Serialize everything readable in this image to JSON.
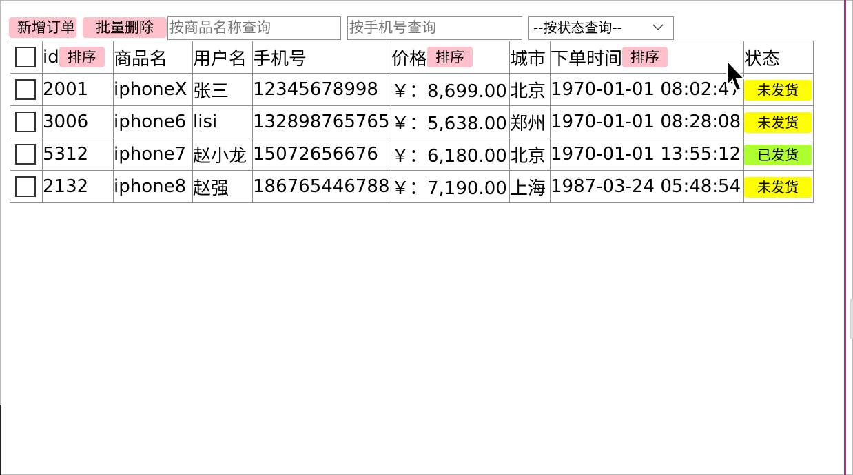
{
  "toolbar": {
    "add_label": "新增订单",
    "batch_delete_label": "批量删除",
    "product_search_placeholder": "按商品名称查询",
    "phone_search_placeholder": "按手机号查询",
    "status_select_value": "--按状态查询--"
  },
  "table": {
    "headers": {
      "id": "id",
      "product": "商品名",
      "username": "用户名",
      "phone": "手机号",
      "price": "价格",
      "city": "城市",
      "order_time": "下单时间",
      "status": "状态",
      "sort_label": "排序"
    },
    "rows": [
      {
        "id": "2001",
        "product": "iphoneX",
        "username": "张三",
        "phone": "12345678998",
        "price": "￥：8,699.00",
        "city": "北京",
        "order_time": "1970-01-01 08:02:47",
        "status": "未发货"
      },
      {
        "id": "3006",
        "product": "iphone6",
        "username": "lisi",
        "phone": "132898765765",
        "price": "￥：5,638.00",
        "city": "郑州",
        "order_time": "1970-01-01 08:28:08",
        "status": "未发货"
      },
      {
        "id": "5312",
        "product": "iphone7",
        "username": "赵小龙",
        "phone": "15072656676",
        "price": "￥：6,180.00",
        "city": "北京",
        "order_time": "1970-01-01 13:55:12",
        "status": "已发货"
      },
      {
        "id": "2132",
        "product": "iphone8",
        "username": "赵强",
        "phone": "186765446788",
        "price": "￥：7,190.00",
        "city": "上海",
        "order_time": "1987-03-24 05:48:54",
        "status": "未发货"
      }
    ]
  },
  "colors": {
    "button_bg": "#ffc0cb",
    "status_pending": "#ffff00",
    "status_shipped": "#adff2f",
    "window_accent": "#a3357a"
  },
  "icons": {
    "select_arrow": "chevron-down-icon",
    "pointer": "mouse-cursor-icon"
  }
}
